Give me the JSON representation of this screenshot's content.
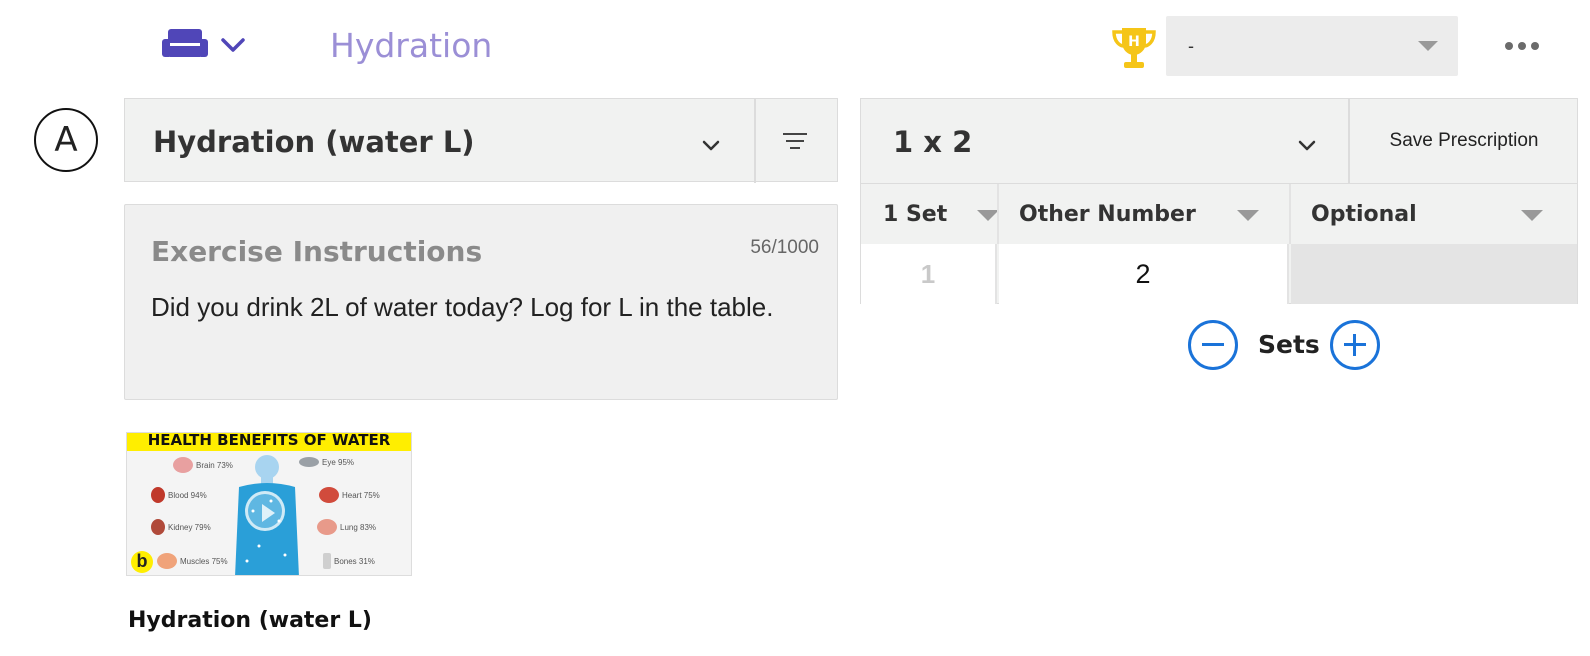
{
  "header": {
    "title": "Hydration",
    "couch_icon": "couch-icon",
    "trophy_icon": "trophy-icon",
    "select_value": "-",
    "more_icon": "more-horizontal-icon"
  },
  "block": {
    "letter": "A"
  },
  "exercise": {
    "name": "Hydration (water L)",
    "instructions_label": "Exercise Instructions",
    "char_count": "56/1000",
    "instructions": "Did you drink 2L of water today? Log for L in the table."
  },
  "video": {
    "banner": "HEALTH BENEFITS OF WATER",
    "badge": "b",
    "caption": "Hydration (water L)",
    "organs": [
      {
        "label": "Brain 73%",
        "color": "#e8a0a0"
      },
      {
        "label": "Eye 95%",
        "color": "#9aa0a6"
      },
      {
        "label": "Blood 94%",
        "color": "#c0392b"
      },
      {
        "label": "Heart 75%",
        "color": "#d14b3c"
      },
      {
        "label": "Kidney 79%",
        "color": "#b04a3a"
      },
      {
        "label": "Lung 83%",
        "color": "#e89a8a"
      },
      {
        "label": "Muscles 75%",
        "color": "#f0a37a"
      },
      {
        "label": "Bones 31%",
        "color": "#cfcfcf"
      }
    ]
  },
  "prescription": {
    "scheme": "1 x 2",
    "save_label": "Save Prescription",
    "columns": [
      "1 Set",
      "Other Number",
      "Optional"
    ],
    "rows": [
      {
        "index": "1",
        "other_number": "2",
        "optional": ""
      }
    ],
    "sets_label": "Sets"
  },
  "colors": {
    "accent": "#1a73d9",
    "title": "#9b8fd6",
    "icon_purple": "#5046b8",
    "trophy": "#f5c518"
  }
}
